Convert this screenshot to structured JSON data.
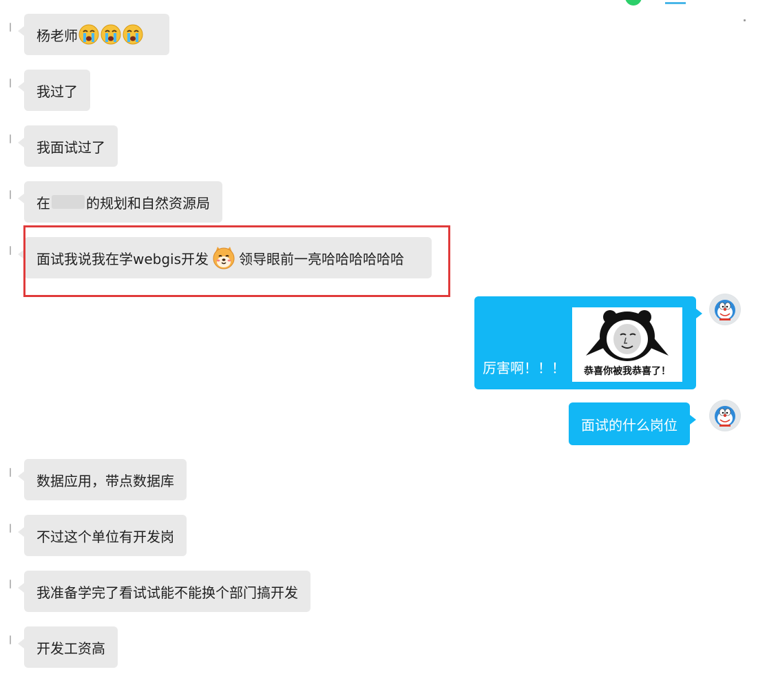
{
  "messages": [
    {
      "id": "m1",
      "text": "杨老师"
    },
    {
      "id": "m2",
      "text": "我过了"
    },
    {
      "id": "m3",
      "text": "我面试过了"
    },
    {
      "id": "m4",
      "prefix": "在",
      "suffix": "的规划和自然资源局"
    },
    {
      "id": "m5",
      "before": "面试我说我在学webgis开发",
      "after": "领导眼前一亮哈哈哈哈哈哈"
    },
    {
      "id": "m6",
      "text": "厉害啊！！！",
      "sticker_caption": "恭喜你被我恭喜了！"
    },
    {
      "id": "m7",
      "text": "面试的什么岗位"
    },
    {
      "id": "m8",
      "text": "数据应用，带点数据库"
    },
    {
      "id": "m9",
      "text": "不过这个单位有开发岗"
    },
    {
      "id": "m10",
      "text": "我准备学完了看试试能不能换个部门搞开发"
    },
    {
      "id": "m11",
      "text": "开发工资高"
    }
  ],
  "icons": {
    "crying": "crying-face-icon",
    "shiba": "shiba-dog-emoji-icon",
    "avatar": "doraemon-avatar-icon",
    "sticker": "panda-meme-sticker-icon"
  },
  "colors": {
    "incoming_bubble": "#e9e9e9",
    "outgoing_bubble": "#12b7f5",
    "highlight": "#e03a3a"
  }
}
